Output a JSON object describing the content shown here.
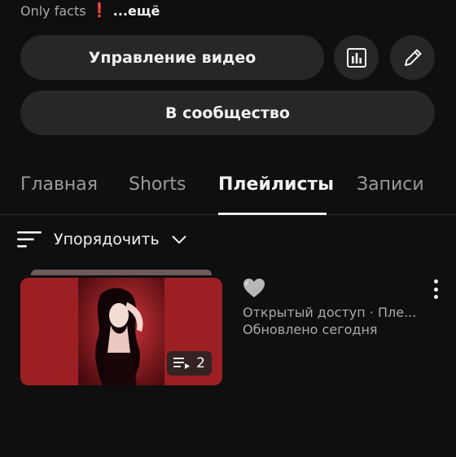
{
  "header": {
    "description": "Only facts",
    "description_mark": "❗",
    "more_label": "...ещё"
  },
  "actions": {
    "manage_video_label": "Управление видео",
    "community_label": "В сообщество"
  },
  "tabs": [
    {
      "label": "Главная",
      "active": false
    },
    {
      "label": "Shorts",
      "active": false
    },
    {
      "label": "Плейлисты",
      "active": true
    },
    {
      "label": "Записи",
      "active": false
    }
  ],
  "sort": {
    "label": "Упорядочить"
  },
  "playlist": {
    "video_count": "2",
    "title_emoji": "🩶",
    "visibility_line": "Открытый доступ · Пле...",
    "updated_line": "Обновлено сегодня"
  },
  "icons": {
    "stats": "bar-chart-icon",
    "edit": "pencil-icon",
    "sort": "sort-lines-icon",
    "chevron": "chevron-down-icon",
    "playlist": "playlist-icon",
    "more": "more-vertical-icon"
  },
  "colors": {
    "background": "#0f0f0f",
    "pill": "#272727",
    "thumbnail": "#9c1f24",
    "accent_mark": "#ff2d2d"
  }
}
